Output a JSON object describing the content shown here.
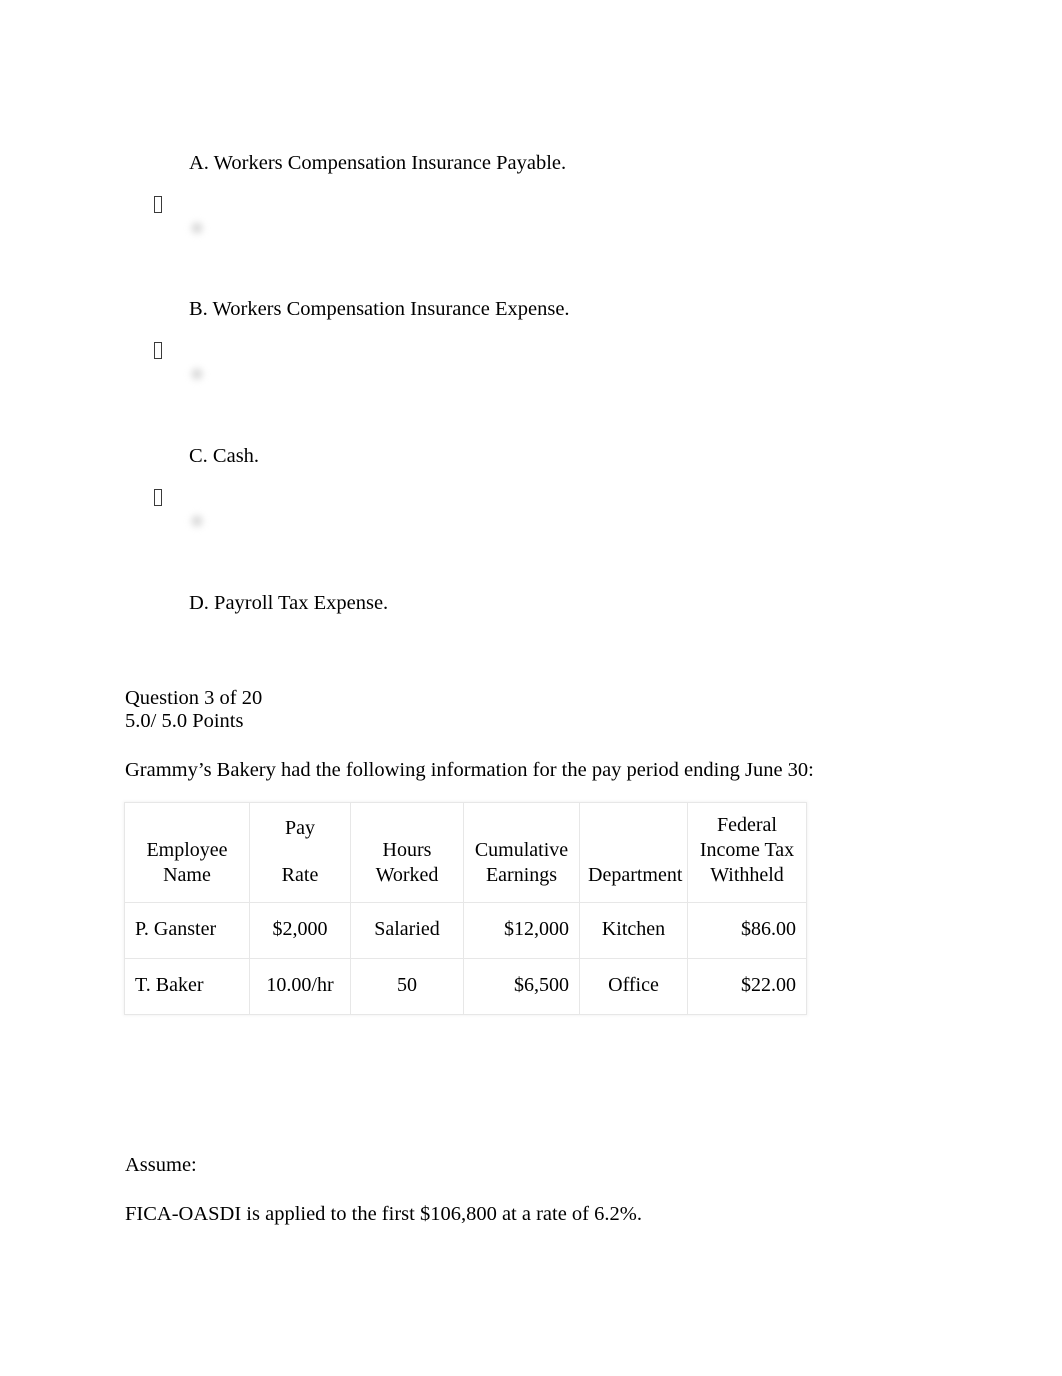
{
  "document": {
    "type": "online-quiz-printout",
    "page_background": "#ffffff",
    "text_color": "#000000"
  },
  "choices": [
    {
      "label": "A. Workers Compensation Insurance Payable.",
      "marker_icon": "missing-glyph-box-icon",
      "radio_icon": "radio-button-icon",
      "selected": false
    },
    {
      "label": "B. Workers Compensation Insurance Expense.",
      "marker_icon": "missing-glyph-box-icon",
      "radio_icon": "radio-button-icon",
      "selected": false
    },
    {
      "label": "C. Cash.",
      "marker_icon": "missing-glyph-box-icon",
      "radio_icon": "radio-button-icon",
      "selected": false
    },
    {
      "label": "D. Payroll Tax Expense.",
      "marker_icon": null,
      "radio_icon": null,
      "selected": false
    }
  ],
  "question": {
    "number_line": "Question 3 of 20",
    "points_line": "5.0/ 5.0 Points",
    "prompt": "Grammy’s Bakery had the following information for the pay period ending June 30:"
  },
  "table": {
    "headers": [
      {
        "lines": [
          "Employee",
          "Name"
        ],
        "align": "center",
        "gap_after_first": false
      },
      {
        "lines": [
          "Pay",
          "Rate"
        ],
        "align": "center",
        "gap_after_first": true
      },
      {
        "lines": [
          "Hours",
          "Worked"
        ],
        "align": "center",
        "gap_after_first": false
      },
      {
        "lines": [
          "Cumulative",
          "Earnings"
        ],
        "align": "center",
        "gap_after_first": false
      },
      {
        "lines": [
          "Department"
        ],
        "align": "center",
        "gap_after_first": false
      },
      {
        "lines": [
          "Federal",
          "Income Tax",
          "Withheld"
        ],
        "align": "center",
        "gap_after_first": false
      }
    ],
    "rows": [
      {
        "employee_name": "P. Ganster",
        "pay_rate": "$2,000",
        "hours_worked": "Salaried",
        "cumulative_earnings": "$12,000",
        "department": "Kitchen",
        "federal_income_tax_withheld": "$86.00"
      },
      {
        "employee_name": "T. Baker",
        "pay_rate": "10.00/hr",
        "hours_worked": "50",
        "cumulative_earnings": "$6,500",
        "department": "Office",
        "federal_income_tax_withheld": "$22.00"
      }
    ],
    "border_color": "#e7e7e7"
  },
  "assumptions": {
    "heading": "Assume:",
    "line_1": "FICA-OASDI is applied to the first $106,800 at a rate of 6.2%."
  }
}
